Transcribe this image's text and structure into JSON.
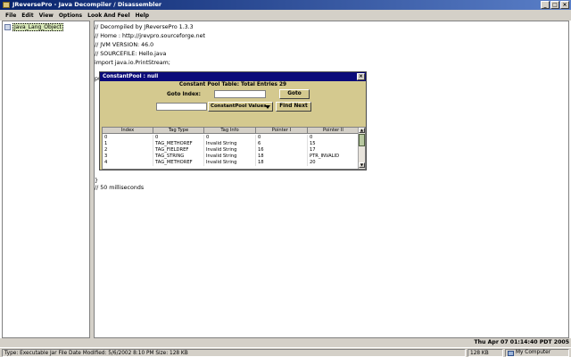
{
  "window": {
    "title": "JReversePro - Java Decompiler / Disassembler",
    "buttons": [
      "_",
      "□",
      "×"
    ]
  },
  "menu": [
    "File",
    "Edit",
    "View",
    "Options",
    "Look And Feel",
    "Help"
  ],
  "sidebar": {
    "items": [
      {
        "label": "Java_Lang_Object"
      }
    ]
  },
  "code": {
    "lines": [
      "// Decompiled by JReversePro 1.3.3",
      "// Home : http://jrevpro.sourceforge.net",
      "// JVM VERSION: 46.0",
      "// SOURCEFILE: Hello.java",
      "import java.io.PrintStream;",
      "",
      "pu",
      "",
      "",
      "",
      "",
      "",
      "",
      "}",
      "// 50 milliseconds"
    ]
  },
  "dialog": {
    "title": "ConstantPool : null",
    "heading": "Constant Pool Table:  Total Entries 29",
    "goto_label": "Goto Index:",
    "goto_button": "Goto",
    "select_value": "ConstantPool Values",
    "find_button": "Find Next",
    "columns": [
      "Index",
      "Tag Type",
      "Tag Info",
      "Pointer I",
      "Pointer II"
    ],
    "rows": [
      [
        "0",
        "0",
        "0",
        "0",
        "0"
      ],
      [
        "1",
        "TAG_METHOREF",
        "Invalid String",
        "6",
        "15"
      ],
      [
        "2",
        "TAG_FIELDREF",
        "Invalid String",
        "16",
        "17"
      ],
      [
        "3",
        "TAG_STRING",
        "Invalid String",
        "18",
        "PTR_INVALID"
      ],
      [
        "4",
        "TAG_METHOREF",
        "Invalid String",
        "18",
        "20"
      ]
    ]
  },
  "status": {
    "datetime": "Thu Apr 07 01:14:40 PDT 2005",
    "file_info": "Type: Executable Jar File Date Modified: 5/6/2002 8:10 PM Size: 128 KB",
    "size": "128 KB",
    "computer": "My Computer"
  },
  "colors": {
    "title_bar": "#07226b",
    "dialog_bg": "#d4c98f",
    "dialog_title": "#0b0b7a",
    "tree_selected": "#d8e8b8"
  }
}
